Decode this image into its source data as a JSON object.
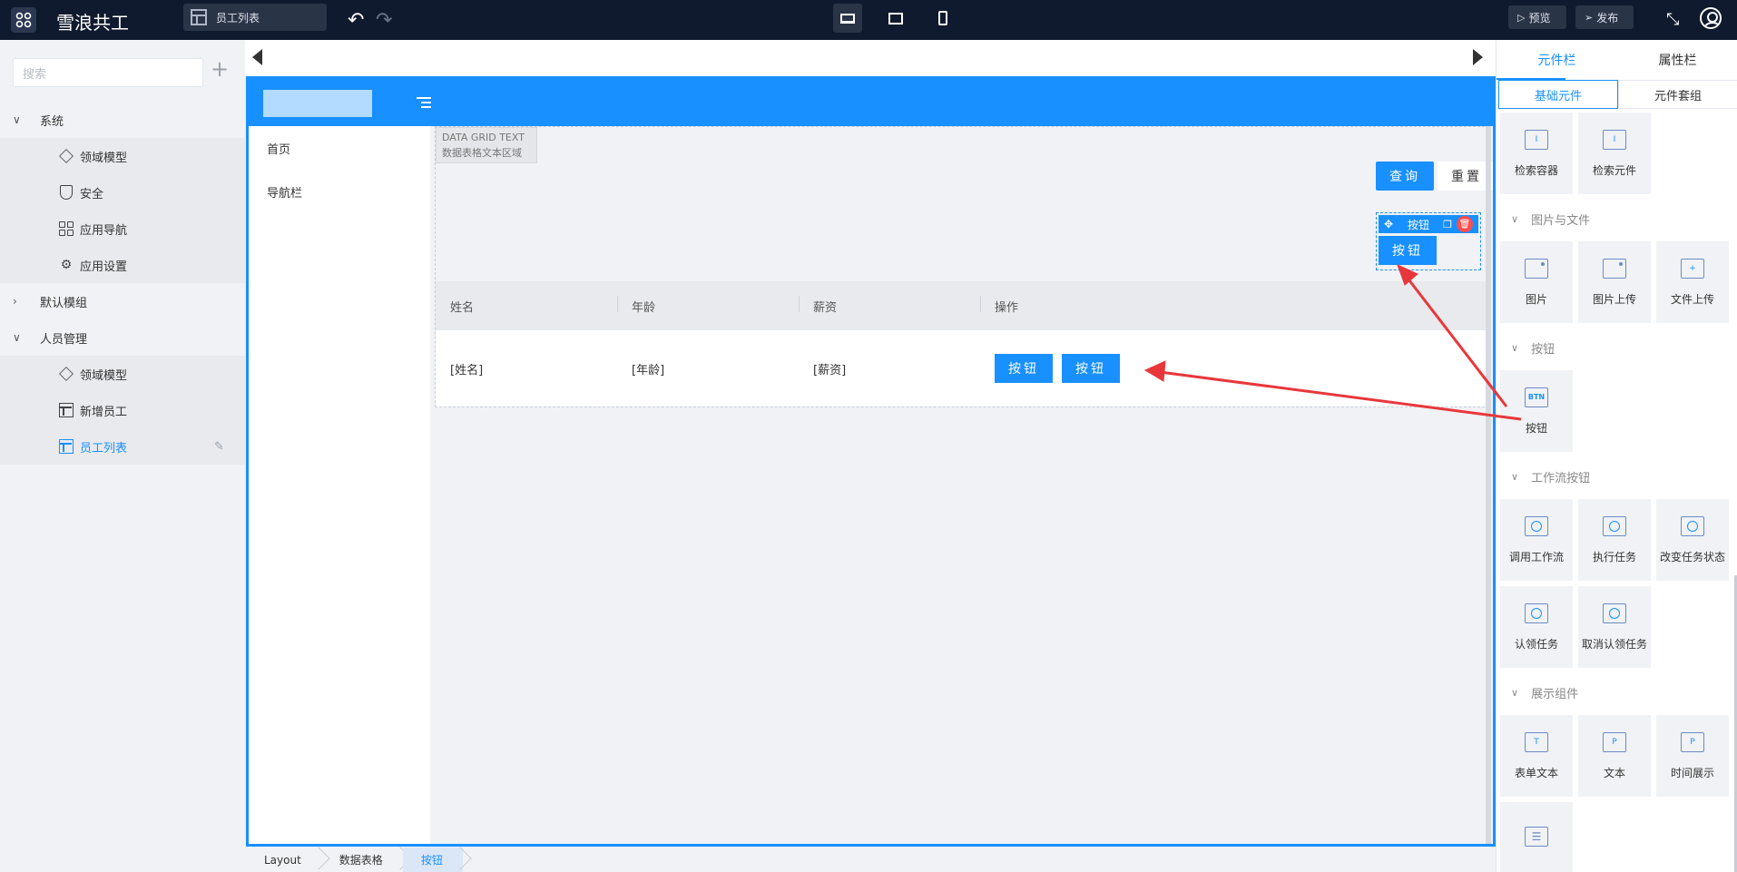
{
  "topbar": {
    "app_title": "雪浪共工",
    "current_page": "员工列表",
    "preview_label": "预览",
    "publish_label": "发布"
  },
  "sidebar": {
    "search_placeholder": "搜索",
    "groups": [
      {
        "label": "系统",
        "expanded": true,
        "children": [
          {
            "label": "领域模型",
            "icon": "cube-icon"
          },
          {
            "label": "安全",
            "icon": "shield-icon"
          },
          {
            "label": "应用导航",
            "icon": "grid-icon"
          },
          {
            "label": "应用设置",
            "icon": "gear-icon"
          }
        ]
      },
      {
        "label": "默认模组",
        "expanded": false,
        "children": []
      },
      {
        "label": "人员管理",
        "expanded": true,
        "children": [
          {
            "label": "领域模型",
            "icon": "cube-icon"
          },
          {
            "label": "新增员工",
            "icon": "table-icon"
          },
          {
            "label": "员工列表",
            "icon": "table-icon",
            "active": true
          }
        ]
      }
    ]
  },
  "canvas": {
    "nav_items": [
      "首页",
      "导航栏"
    ],
    "data_grid_tag_line1": "DATA GRID TEXT",
    "data_grid_tag_line2": "数据表格文本区域",
    "query_label": "查询",
    "reset_label": "重置",
    "selected_label": "按钮",
    "selected_button_label": "按钮",
    "table": {
      "columns": [
        "姓名",
        "年龄",
        "薪资",
        "操作"
      ],
      "row": [
        "[姓名]",
        "[年龄]",
        "[薪资]"
      ],
      "row_buttons": [
        "按钮",
        "按钮"
      ]
    }
  },
  "breadcrumb": [
    "Layout",
    "数据表格",
    "按钮"
  ],
  "right_panel": {
    "tabs": [
      "元件栏",
      "属性栏"
    ],
    "subtabs": [
      "基础元件",
      "元件套组"
    ],
    "top_items": [
      "检索容器",
      "检索元件"
    ],
    "sections": [
      {
        "title": "图片与文件",
        "items": [
          "图片",
          "图片上传",
          "文件上传"
        ]
      },
      {
        "title": "按钮",
        "items": [
          "按钮"
        ]
      },
      {
        "title": "工作流按钮",
        "items": [
          "调用工作流",
          "执行任务",
          "改变任务状态",
          "认领任务",
          "取消认领任务"
        ]
      },
      {
        "title": "展示组件",
        "items": [
          "表单文本",
          "文本",
          "时间展示"
        ]
      }
    ]
  },
  "colors": {
    "primary": "#1890ff",
    "topbar": "#0f1a2e",
    "danger": "#ff4d4f",
    "annotation": "#e8373b"
  }
}
